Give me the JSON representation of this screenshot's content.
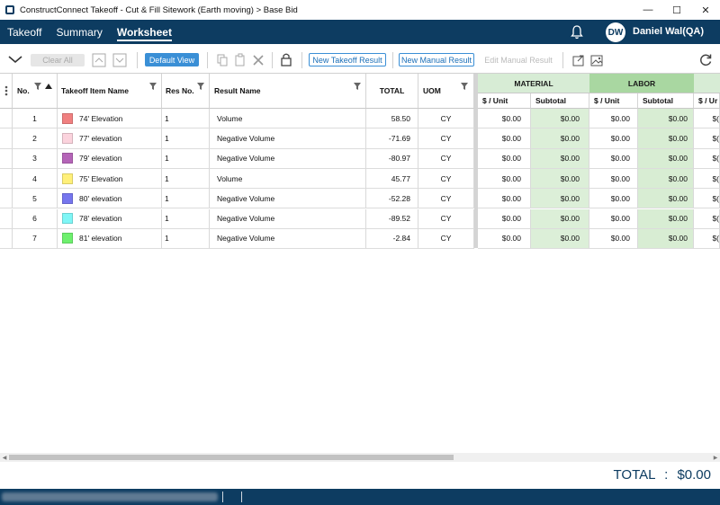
{
  "window": {
    "title": "ConstructConnect Takeoff - Cut & Fill Sitework (Earth moving) > Base Bid"
  },
  "nav": {
    "tabs": [
      "Takeoff",
      "Summary",
      "Worksheet"
    ],
    "active_tab": "Worksheet",
    "avatar_initials": "DW",
    "user_name": "Daniel Wal(QA)"
  },
  "toolbar": {
    "clear_all": "Clear All",
    "default_view": "Default View",
    "new_takeoff_result": "New Takeoff Result",
    "new_manual_result": "New Manual Result",
    "edit_manual_result": "Edit Manual Result"
  },
  "grid": {
    "columns": {
      "no": "No.",
      "item": "Takeoff Item Name",
      "res_no": "Res No.",
      "result_name": "Result Name",
      "total": "TOTAL",
      "uom": "UOM"
    },
    "groups": {
      "material": "MATERIAL",
      "labor": "LABOR"
    },
    "subcolumns": {
      "per_unit": "$ / Unit",
      "subtotal": "Subtotal",
      "per_unit_partial": "$ / Ur"
    },
    "rows": [
      {
        "no": "1",
        "item": "74' Elevation",
        "color": "#f08080",
        "res_no": "1",
        "result": "Volume",
        "total": "58.50",
        "uom": "CY",
        "mat_unit": "$0.00",
        "mat_sub": "$0.00",
        "lab_unit": "$0.00",
        "lab_sub": "$0.00",
        "extra": "$("
      },
      {
        "no": "2",
        "item": "77' elevation",
        "color": "#fbd3dd",
        "res_no": "1",
        "result": "Negative Volume",
        "total": "-71.69",
        "uom": "CY",
        "mat_unit": "$0.00",
        "mat_sub": "$0.00",
        "lab_unit": "$0.00",
        "lab_sub": "$0.00",
        "extra": "$("
      },
      {
        "no": "3",
        "item": "79' elevation",
        "color": "#b565b8",
        "res_no": "1",
        "result": "Negative Volume",
        "total": "-80.97",
        "uom": "CY",
        "mat_unit": "$0.00",
        "mat_sub": "$0.00",
        "lab_unit": "$0.00",
        "lab_sub": "$0.00",
        "extra": "$("
      },
      {
        "no": "4",
        "item": "75' Elevation",
        "color": "#fff07a",
        "res_no": "1",
        "result": "Volume",
        "total": "45.77",
        "uom": "CY",
        "mat_unit": "$0.00",
        "mat_sub": "$0.00",
        "lab_unit": "$0.00",
        "lab_sub": "$0.00",
        "extra": "$("
      },
      {
        "no": "5",
        "item": "80' elevation",
        "color": "#7676ee",
        "res_no": "1",
        "result": "Negative Volume",
        "total": "-52.28",
        "uom": "CY",
        "mat_unit": "$0.00",
        "mat_sub": "$0.00",
        "lab_unit": "$0.00",
        "lab_sub": "$0.00",
        "extra": "$("
      },
      {
        "no": "6",
        "item": "78' elevation",
        "color": "#7ff6f6",
        "res_no": "1",
        "result": "Negative Volume",
        "total": "-89.52",
        "uom": "CY",
        "mat_unit": "$0.00",
        "mat_sub": "$0.00",
        "lab_unit": "$0.00",
        "lab_sub": "$0.00",
        "extra": "$("
      },
      {
        "no": "7",
        "item": "81' elevation",
        "color": "#6ef06e",
        "res_no": "1",
        "result": "Negative Volume",
        "total": "-2.84",
        "uom": "CY",
        "mat_unit": "$0.00",
        "mat_sub": "$0.00",
        "lab_unit": "$0.00",
        "lab_sub": "$0.00",
        "extra": "$("
      }
    ]
  },
  "footer": {
    "total_label": "TOTAL",
    "total_value": "$0.00"
  },
  "colors": {
    "brand_navy": "#0d3c61",
    "material_header": "#d7ecd5",
    "labor_header": "#a9d7a1",
    "labor_subtotal": "#d8edd3",
    "accent_blue": "#3a8fd6"
  }
}
